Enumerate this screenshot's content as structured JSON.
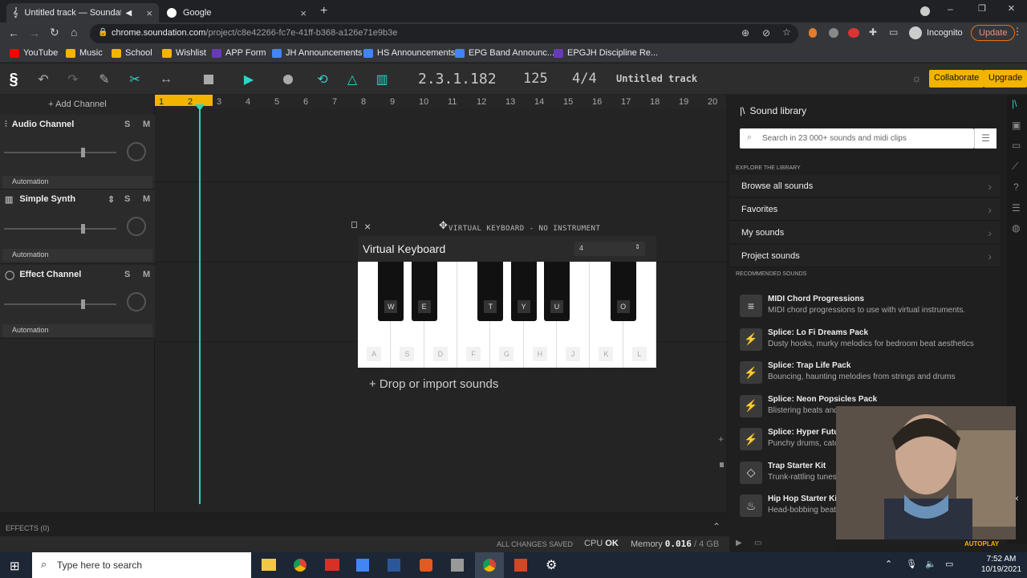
{
  "browser": {
    "tabs": [
      {
        "title": "Untitled track — Soundation",
        "active": true
      },
      {
        "title": "Google",
        "active": false
      }
    ],
    "url_host": "chrome.soundation.com",
    "url_path": "/project/c8e42266-fc7e-41ff-b368-a126e71e9b3e",
    "profile": "Incognito",
    "update_label": "Update",
    "bookmarks": [
      {
        "label": "YouTube",
        "color": "#ff0000"
      },
      {
        "label": "Music",
        "color": "#f4b400"
      },
      {
        "label": "School",
        "color": "#f4b400"
      },
      {
        "label": "Wishlist",
        "color": "#f4b400"
      },
      {
        "label": "APP Form",
        "color": "#673ab7"
      },
      {
        "label": "JH Announcements",
        "color": "#4285f4"
      },
      {
        "label": "HS Announcements",
        "color": "#4285f4"
      },
      {
        "label": "EPG Band Announc...",
        "color": "#4285f4"
      },
      {
        "label": "EPGJH Discipline Re...",
        "color": "#673ab7"
      }
    ]
  },
  "toolbar": {
    "position": "2.3.1.182",
    "bpm": "125",
    "signature": "4/4",
    "track_title": "Untitled track",
    "collaborate_label": "Collaborate",
    "upgrade_label": "Upgrade"
  },
  "channels": {
    "add_label": "+ Add Channel",
    "list": [
      {
        "name": "Audio Channel",
        "automation": "Automation"
      },
      {
        "name": "Simple Synth",
        "automation": "Automation"
      },
      {
        "name": "Effect Channel",
        "automation": "Automation"
      }
    ],
    "solo": "S",
    "mute": "M"
  },
  "ruler": [
    "1",
    "2",
    "3",
    "4",
    "5",
    "6",
    "7",
    "8",
    "9",
    "10",
    "11",
    "12",
    "13",
    "14",
    "15",
    "16",
    "17",
    "18",
    "19",
    "20"
  ],
  "virtual_keyboard": {
    "header": "VIRTUAL KEYBOARD - NO INSTRUMENT",
    "title": "Virtual Keyboard",
    "octave": "4",
    "white_keys": [
      "A",
      "S",
      "D",
      "F",
      "G",
      "H",
      "J",
      "K",
      "L"
    ],
    "black_keys": [
      "W",
      "E",
      "T",
      "Y",
      "U",
      "O"
    ]
  },
  "drop_label": "+ Drop or import sounds",
  "library": {
    "title": "Sound library",
    "search_placeholder": "Search in 23 000+ sounds and midi clips",
    "explore_heading": "EXPLORE THE LIBRARY",
    "explore": [
      "Browse all sounds",
      "Favorites",
      "My sounds",
      "Project sounds"
    ],
    "recommended_heading": "RECOMMENDED SOUNDS",
    "recommended": [
      {
        "title": "MIDI Chord Progressions",
        "sub": "MIDI chord progressions to use with virtual instruments."
      },
      {
        "title": "Splice: Lo Fi Dreams Pack",
        "sub": "Dusty hooks, murky melodics for bedroom beat aesthetics"
      },
      {
        "title": "Splice: Trap Life Pack",
        "sub": "Bouncing, haunting melodies from strings and drums"
      },
      {
        "title": "Splice: Neon Popsicles Pack",
        "sub": "Blistering beats and"
      },
      {
        "title": "Splice: Hyper Future",
        "sub": "Punchy drums, catc essentials"
      },
      {
        "title": "Trap Starter Kit",
        "sub": "Trunk-rattling tunes"
      },
      {
        "title": "Hip Hop Starter Kit",
        "sub": "Head-bobbing beat"
      }
    ],
    "autoplay": "AUTOPLAY"
  },
  "status": {
    "effects": "EFFECTS (0)",
    "saved": "ALL CHANGES SAVED",
    "cpu_label": "CPU",
    "cpu_value": "OK",
    "memory_label": "Memory",
    "memory_value": "0.016",
    "memory_total": "/ 4  GB"
  },
  "taskbar": {
    "search_placeholder": "Type here to search",
    "time": "7:52 AM",
    "date": "10/19/2021"
  }
}
